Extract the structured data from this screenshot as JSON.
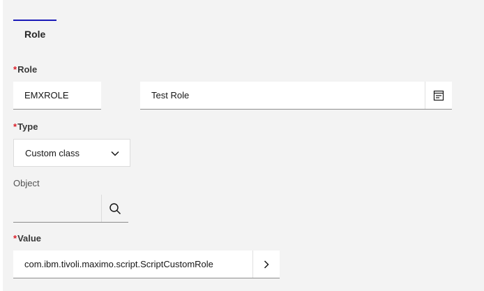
{
  "section": {
    "title": "Role"
  },
  "role_field": {
    "label": "Role",
    "required_mark": "*",
    "value": "EMXROLE",
    "description": "Test Role",
    "lookup_icon": "detail-lookup-icon"
  },
  "type_field": {
    "label": "Type",
    "required_mark": "*",
    "selected": "Custom class",
    "dropdown_icon": "chevron-down-icon"
  },
  "object_field": {
    "label": "Object",
    "value": "",
    "search_icon": "search-icon"
  },
  "value_field": {
    "label": "Value",
    "required_mark": "*",
    "value": "com.ibm.tivoli.maximo.script.ScriptCustomRole",
    "nav_icon": "chevron-right-icon"
  },
  "colors": {
    "background": "#f3f3f3",
    "required": "#da1e28",
    "tab_indicator": "#1a1ab8"
  }
}
